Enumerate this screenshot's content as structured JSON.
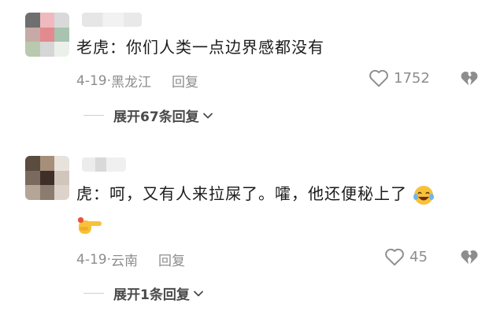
{
  "comments": [
    {
      "text": "老虎：你们人类一点边界感都没有",
      "date": "4-19",
      "location": "黑龙江",
      "reply_label": "回复",
      "like_count": "1752",
      "expand_label": "展开67条回复",
      "avatar_colors": [
        "#6f6f6f",
        "#f0b9bf",
        "#d9d9d9",
        "#c7aaa5",
        "#e38a8e",
        "#a8c3b0",
        "#b9c9ad",
        "#d6d6d6",
        "#ecf0ea"
      ]
    },
    {
      "text": "虎：呵，又有人来拉屎了。嚯，他还便秘上了",
      "date": "4-19",
      "location": "云南",
      "reply_label": "回复",
      "like_count": "45",
      "expand_label": "展开1条回复",
      "avatar_colors": [
        "#5b4c40",
        "#a68f7a",
        "#e8e2dc",
        "#7a6a5e",
        "#3e3028",
        "#d1c6bc",
        "#b4a596",
        "#8c7c70",
        "#ddd3ca"
      ]
    }
  ],
  "icons": {
    "like": "heart-outline-icon",
    "dislike": "broken-heart-icon",
    "expand": "chevron-down-icon",
    "emoji_laugh": "tears-of-joy-emoji",
    "emoji_point": "backhand-index-pointing-right-emoji"
  },
  "colors": {
    "text": "#1b1b1b",
    "meta": "#8d8d8d",
    "emoji_yellow": "#f7c23a"
  }
}
